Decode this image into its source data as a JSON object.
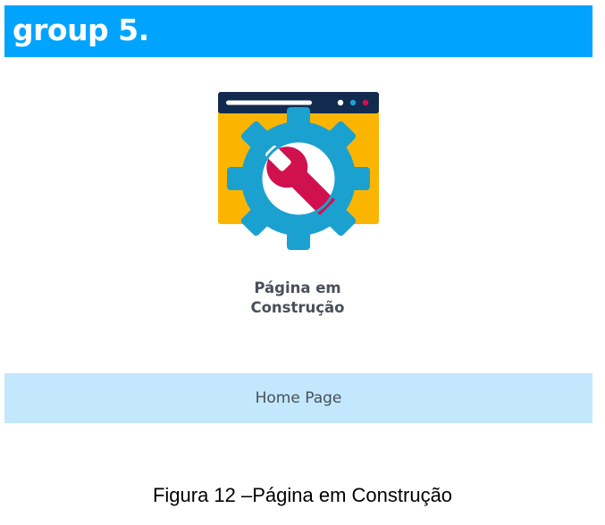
{
  "header": {
    "brand": "group 5.",
    "background_color": "#00a4ff"
  },
  "illustration": {
    "icon": "under-construction-gear-wrench",
    "colors": {
      "window_bar": "#132a4f",
      "window_body": "#fbb500",
      "gear": "#1ba1d0",
      "wrench": "#d1104f",
      "dot_1": "#ffffff",
      "dot_2": "#1ba1d0",
      "dot_3": "#d1104f"
    }
  },
  "main": {
    "caption_line1": "Página em",
    "caption_line2": "Construção"
  },
  "nav": {
    "home_label": "Home Page",
    "background_color": "#c3e7fd"
  },
  "figure": {
    "caption": "Figura 12 –Página em Construção"
  }
}
